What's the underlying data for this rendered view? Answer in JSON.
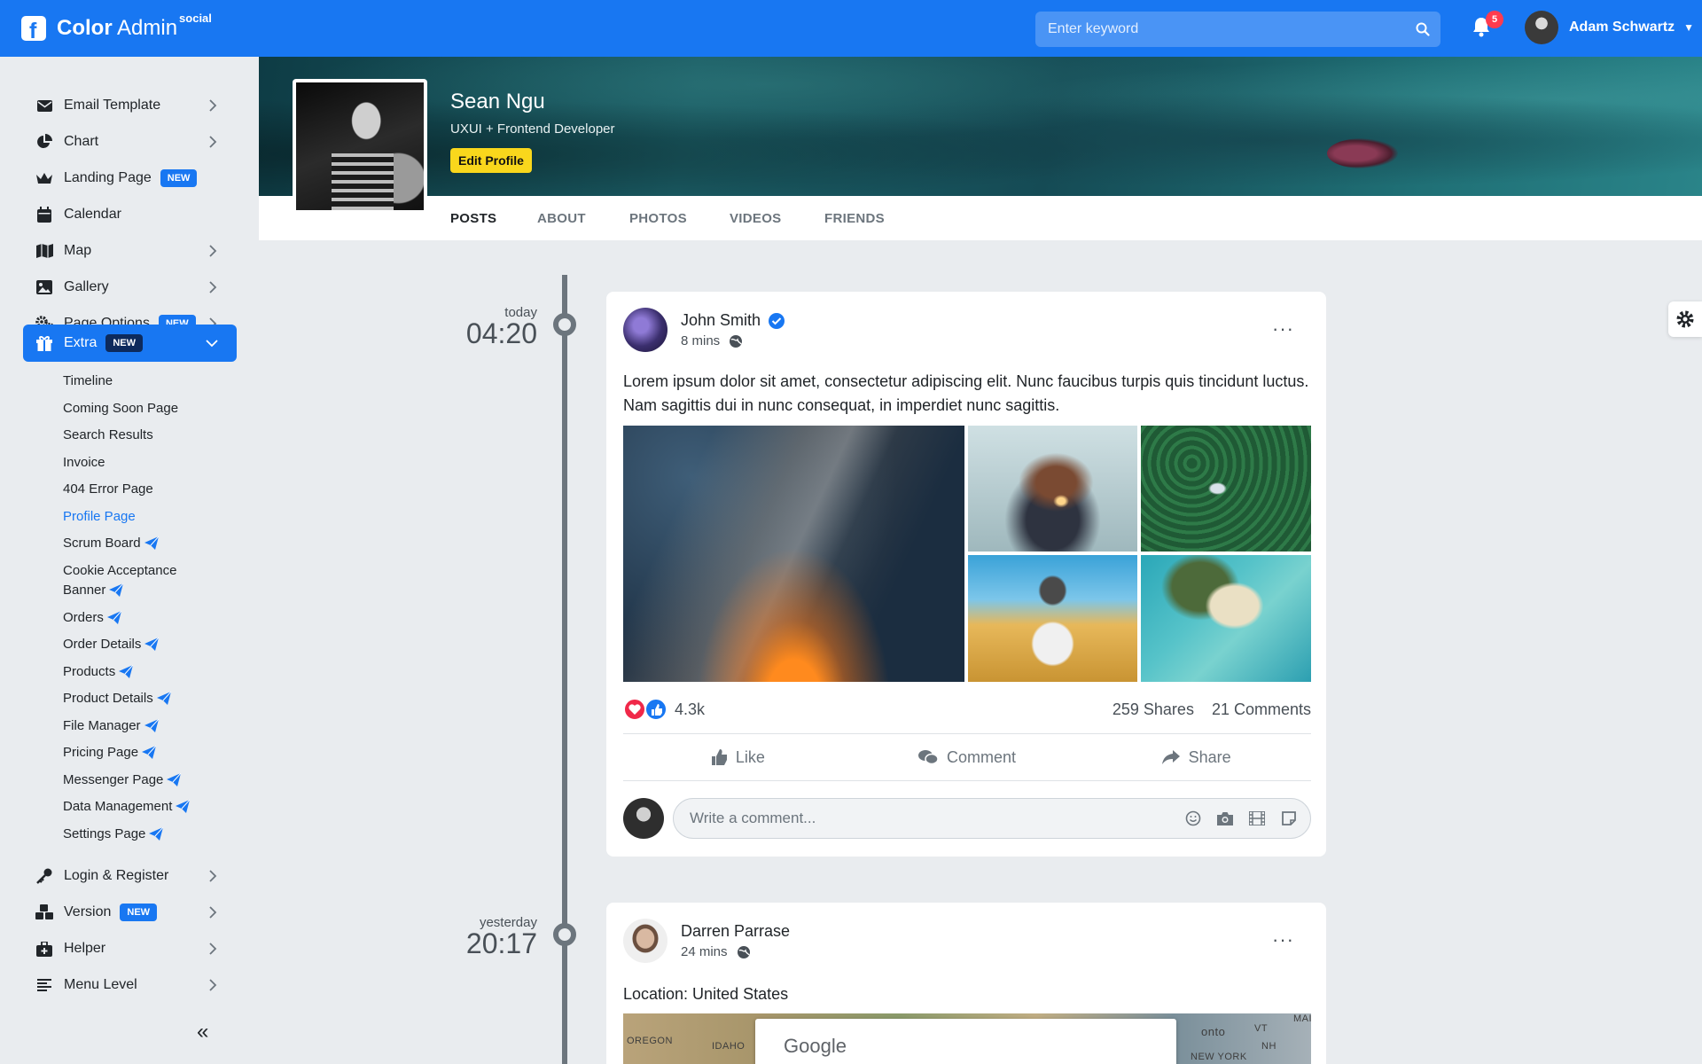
{
  "app": {
    "brand_main": "Color",
    "brand_light": " Admin",
    "brand_sup": "social",
    "brand_logo_letter": "f"
  },
  "header": {
    "search_placeholder": "Enter keyword",
    "notification_count": "5",
    "user_name": "Adam Schwartz"
  },
  "sidebar": {
    "items": [
      {
        "label": "Email Template",
        "icon": "envelope-icon",
        "chevron": true
      },
      {
        "label": "Chart",
        "icon": "pie-chart-icon",
        "chevron": true
      },
      {
        "label": "Landing Page",
        "icon": "crown-icon",
        "badge": "NEW"
      },
      {
        "label": "Calendar",
        "icon": "calendar-icon"
      },
      {
        "label": "Map",
        "icon": "map-icon",
        "chevron": true
      },
      {
        "label": "Gallery",
        "icon": "image-icon",
        "chevron": true
      },
      {
        "label": "Page Options",
        "icon": "gears-icon",
        "badge": "NEW",
        "chevron": true
      },
      {
        "label": "Extra",
        "icon": "gift-icon",
        "badge": "NEW",
        "expanded": true
      },
      {
        "label": "Login & Register",
        "icon": "key-icon",
        "chevron": true
      },
      {
        "label": "Version",
        "icon": "cubes-icon",
        "badge": "NEW",
        "chevron": true
      },
      {
        "label": "Helper",
        "icon": "medkit-icon",
        "chevron": true
      },
      {
        "label": "Menu Level",
        "icon": "align-left-icon",
        "chevron": true
      }
    ],
    "extra_sub": [
      {
        "label": "Timeline"
      },
      {
        "label": "Coming Soon Page"
      },
      {
        "label": "Search Results"
      },
      {
        "label": "Invoice"
      },
      {
        "label": "404 Error Page"
      },
      {
        "label": "Profile Page",
        "current": true
      },
      {
        "label": "Scrum Board",
        "new": true
      },
      {
        "label": "Cookie Acceptance",
        "label2": "Banner",
        "new": true
      },
      {
        "label": "Orders",
        "new": true
      },
      {
        "label": "Order Details",
        "new": true
      },
      {
        "label": "Products",
        "new": true
      },
      {
        "label": "Product Details",
        "new": true
      },
      {
        "label": "File Manager",
        "new": true
      },
      {
        "label": "Pricing Page",
        "new": true
      },
      {
        "label": "Messenger Page",
        "new": true
      },
      {
        "label": "Data Management",
        "new": true
      },
      {
        "label": "Settings Page",
        "new": true
      }
    ],
    "collapse_icon": "«"
  },
  "profile": {
    "name": "Sean Ngu",
    "role": "UXUI + Frontend Developer",
    "edit_label": "Edit Profile",
    "tabs": [
      "POSTS",
      "ABOUT",
      "PHOTOS",
      "VIDEOS",
      "FRIENDS"
    ],
    "active_tab": "POSTS"
  },
  "timeline": [
    {
      "day": "today",
      "time": "04:20",
      "author": "John Smith",
      "verified": true,
      "ago": "8 mins",
      "text": "Lorem ipsum dolor sit amet, consectetur adipiscing elit. Nunc faucibus turpis quis tincidunt luctus. Nam sagittis dui in nunc consequat, in imperdiet nunc sagittis.",
      "reactions": "4.3k",
      "shares": "259 Shares",
      "comments": "21 Comments",
      "actions": [
        "Like",
        "Comment",
        "Share"
      ],
      "comment_placeholder": "Write a comment..."
    },
    {
      "day": "yesterday",
      "time": "20:17",
      "author": "Darren Parrase",
      "ago": "24 mins",
      "text": "Location: United States",
      "map_labels": [
        "OREGON",
        "IDAHO",
        "Google",
        "onto",
        "VT",
        "MAI",
        "NH",
        "NEW YORK"
      ]
    }
  ],
  "colors": {
    "primary": "#1877f2",
    "badge_red": "#ff3b4f",
    "edit_yellow": "#f9d71c"
  }
}
